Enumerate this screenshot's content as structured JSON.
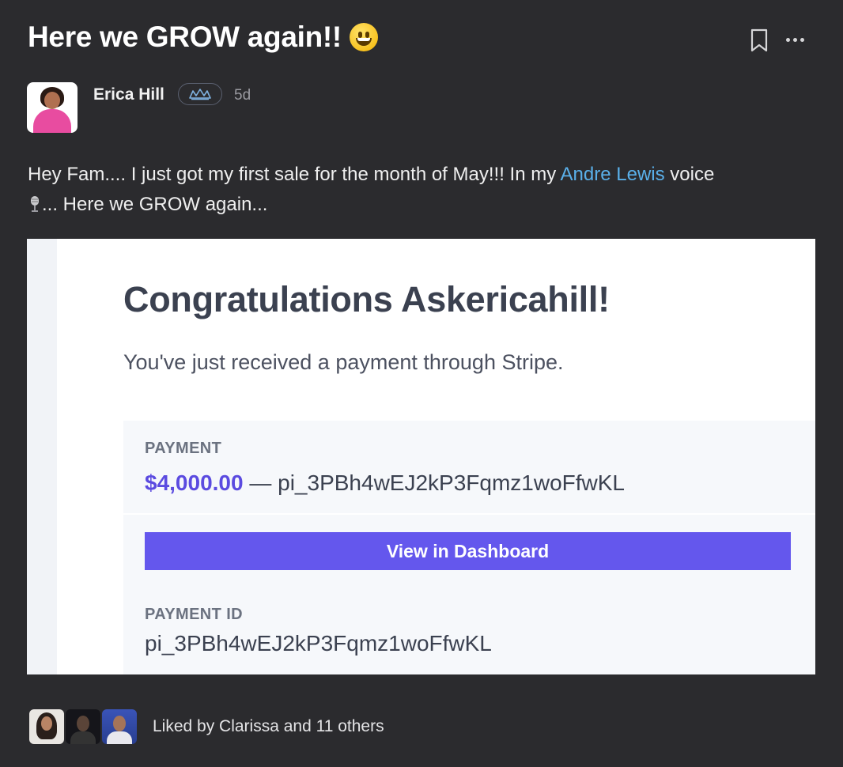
{
  "post": {
    "title": "Here we GROW again!!",
    "title_emoji": "grinning-face-emoji",
    "author": {
      "name": "Erica Hill",
      "badge_icon": "crown-icon",
      "time_ago": "5d"
    },
    "body": {
      "part1": "Hey Fam.... I just got my first sale for the month of May!!! In my ",
      "mention": "Andre Lewis",
      "part2": " voice",
      "part3": "... Here we GROW again..."
    }
  },
  "screenshot": {
    "heading": "Congratulations Askericahill!",
    "subtext": "You've just received a payment through Stripe.",
    "payment_label": "PAYMENT",
    "amount": "$4,000.00",
    "amount_suffix": " — pi_3PBh4wEJ2kP3Fqmz1woFfwKL",
    "button_label": "View in Dashboard",
    "payment_id_label": "PAYMENT ID",
    "payment_id": "pi_3PBh4wEJ2kP3Fqmz1woFfwKL"
  },
  "likes": {
    "text": "Liked by Clarissa and 11 others"
  },
  "colors": {
    "background": "#2b2b2e",
    "mention": "#5ab0ea",
    "stripe_accent": "#6457ed",
    "amount": "#5b4be0"
  }
}
